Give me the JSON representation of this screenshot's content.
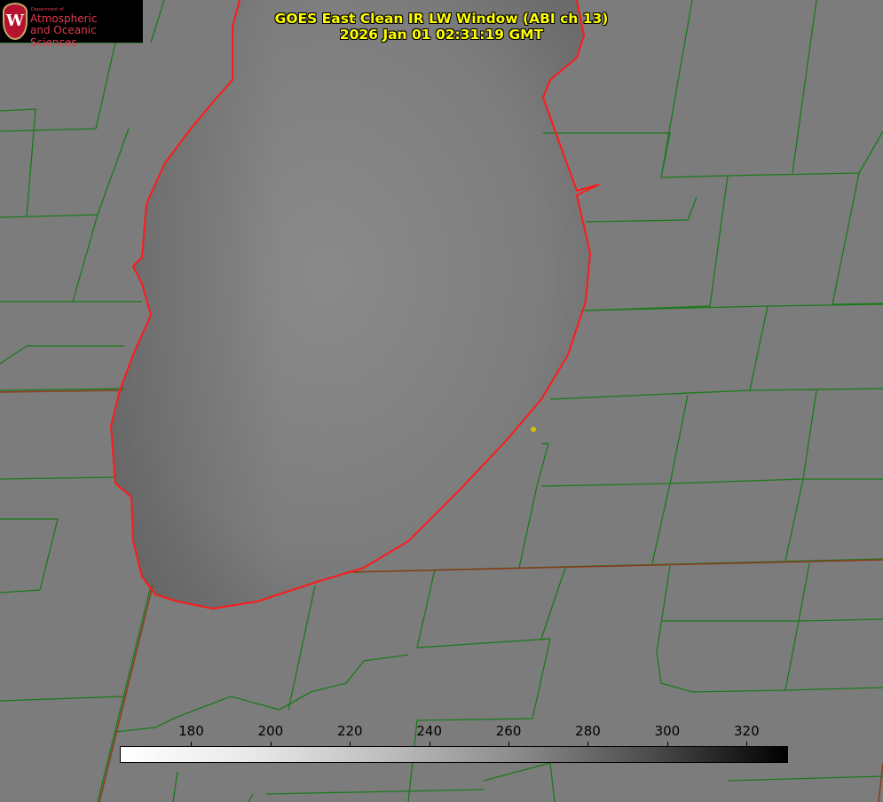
{
  "title": {
    "line1": "GOES East Clean IR LW Window (ABI ch 13)",
    "line2": "2026 Jan 01 02:31:19 GMT"
  },
  "logo": {
    "department": "Department of",
    "line1": "Atmospheric",
    "line2": "and Oceanic Sciences",
    "seal_letter": "W"
  },
  "colorbar": {
    "unit_range": [
      162,
      330
    ],
    "ticks": [
      "180",
      "200",
      "220",
      "240",
      "260",
      "280",
      "300",
      "320"
    ],
    "tick_values": [
      180,
      200,
      220,
      240,
      260,
      280,
      300,
      320
    ]
  },
  "colors": {
    "county_lines": "#1a7a1a",
    "coastline": "#ff1a1a",
    "marker": "#d4c400",
    "title_text": "#ffff00"
  }
}
